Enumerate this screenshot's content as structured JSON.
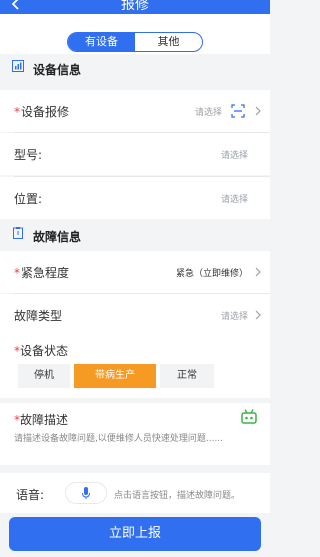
{
  "header": {
    "title": "报修",
    "back_icon": "chevron-left-icon"
  },
  "tabs": {
    "selected": "有设备",
    "other": "其他"
  },
  "equipment_section": {
    "title": "设备信息",
    "icon": "chart-icon",
    "repair": {
      "label": "设备报修",
      "value": "请选择",
      "icon": "scan-icon"
    },
    "model": {
      "label": "型号:",
      "value": "请选择"
    },
    "location": {
      "label": "位置:",
      "value": "请选择"
    }
  },
  "fault_section": {
    "title": "故障信息",
    "icon": "clipboard-icon",
    "urgency": {
      "label": "紧急程度",
      "value": "紧急（立即维修）"
    },
    "fault_type": {
      "label": "故障类型",
      "value": "请选择"
    },
    "status": {
      "label": "设备状态",
      "options": [
        "停机",
        "带病生产",
        "正常"
      ],
      "selected": "带病生产"
    },
    "description": {
      "label": "故障描述",
      "placeholder": "请描述设备故障问题,以便维修人员快速处理问题......",
      "icon": "robot-icon"
    }
  },
  "voice": {
    "label": "语音:",
    "hint": "点击语言按钮，描述故障问题。",
    "icon": "microphone-icon"
  },
  "submit_label": "立即上报",
  "colors": {
    "primary": "#2f6ff0",
    "required": "#e94141",
    "selected_option": "#f59a23",
    "robot": "#3bb24a"
  }
}
